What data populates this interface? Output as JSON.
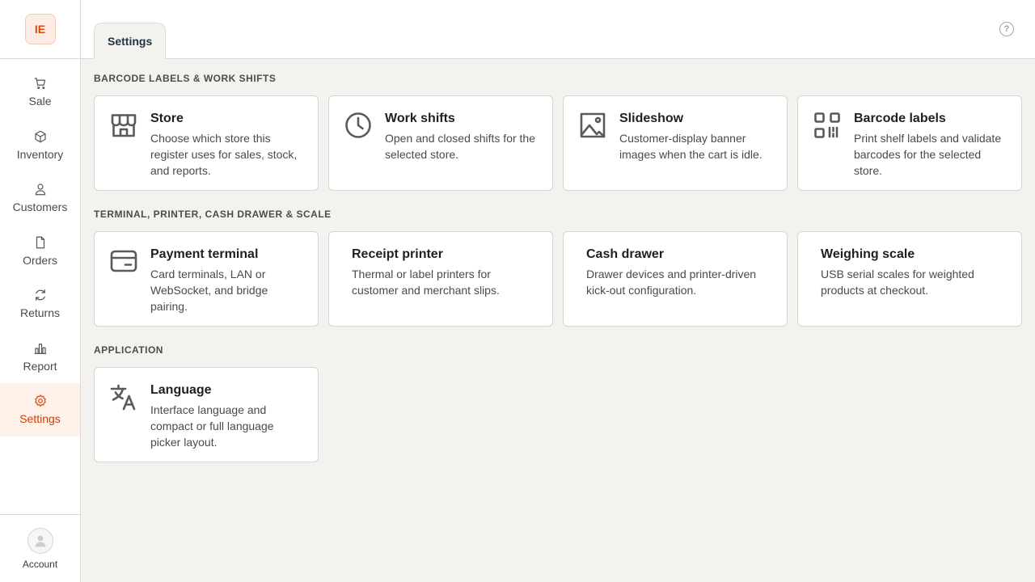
{
  "app": {
    "logo_text": "IE"
  },
  "sidebar": {
    "items": [
      {
        "label": "Sale",
        "icon": "cart-icon"
      },
      {
        "label": "Inventory",
        "icon": "box-icon"
      },
      {
        "label": "Customers",
        "icon": "user-icon"
      },
      {
        "label": "Orders",
        "icon": "document-icon"
      },
      {
        "label": "Returns",
        "icon": "refresh-icon"
      },
      {
        "label": "Report",
        "icon": "bar-chart-icon"
      },
      {
        "label": "Settings",
        "icon": "gear-icon",
        "active": true
      }
    ],
    "account_label": "Account"
  },
  "header": {
    "tab_label": "Settings",
    "help_icon": "help-icon",
    "help_glyph": "?"
  },
  "sections": [
    {
      "title": "BARCODE LABELS & WORK SHIFTS",
      "cards": [
        {
          "title": "Store",
          "desc": "Choose which store this register uses for sales, stock, and reports.",
          "icon": "store-icon"
        },
        {
          "title": "Work shifts",
          "desc": "Open and closed shifts for the selected store.",
          "icon": "clock-icon"
        },
        {
          "title": "Slideshow",
          "desc": "Customer-display banner images when the cart is idle.",
          "icon": "image-icon"
        },
        {
          "title": "Barcode labels",
          "desc": "Print shelf labels and validate barcodes for the selected store.",
          "icon": "qr-code-icon"
        }
      ]
    },
    {
      "title": "TERMINAL, PRINTER, CASH DRAWER & SCALE",
      "cards": [
        {
          "title": "Payment terminal",
          "desc": "Card terminals, LAN or WebSocket, and bridge pairing.",
          "icon": "credit-card-icon"
        },
        {
          "title": "Receipt printer",
          "desc": "Thermal or label printers for customer and merchant slips."
        },
        {
          "title": "Cash drawer",
          "desc": "Drawer devices and printer-driven kick-out configuration."
        },
        {
          "title": "Weighing scale",
          "desc": "USB serial scales for weighted products at checkout."
        }
      ]
    },
    {
      "title": "APPLICATION",
      "cards": [
        {
          "title": "Language",
          "desc": "Interface language and compact or full language picker layout.",
          "icon": "translate-icon"
        }
      ]
    }
  ],
  "colors": {
    "accent": "#d24a13",
    "background": "#f3f2ef",
    "card": "#ffffff"
  }
}
